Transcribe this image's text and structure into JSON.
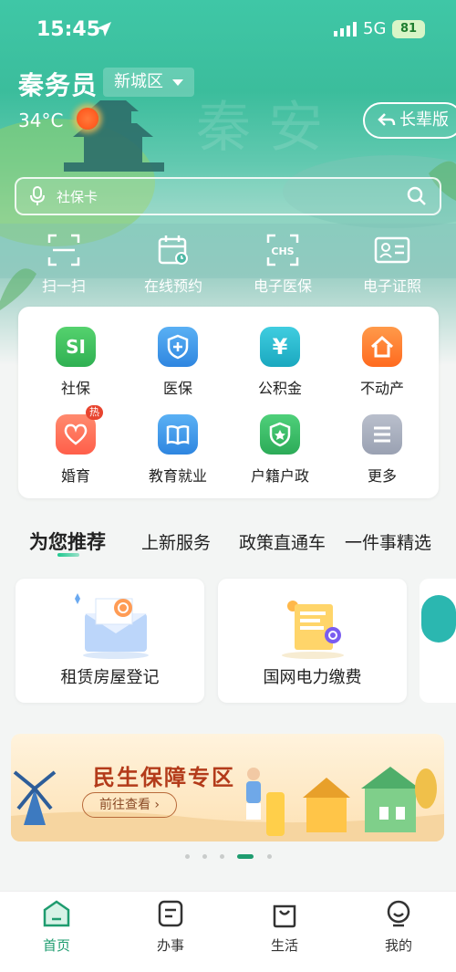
{
  "status_bar": {
    "time": "15:45",
    "network": "5G",
    "battery": "81"
  },
  "header": {
    "user_name": "秦务员",
    "district": "新城区",
    "temperature": "34°C",
    "elder_mode_label": "长辈版"
  },
  "search": {
    "placeholder": "社保卡"
  },
  "quick_actions": [
    {
      "label": "扫一扫",
      "icon": "scan-icon"
    },
    {
      "label": "在线预约",
      "icon": "calendar-icon"
    },
    {
      "label": "电子医保",
      "icon": "chs-icon"
    },
    {
      "label": "电子证照",
      "icon": "id-card-icon"
    }
  ],
  "services": [
    {
      "label": "社保",
      "icon": "si-icon",
      "color": "#3cc15a",
      "glyph": "SI"
    },
    {
      "label": "医保",
      "icon": "shield-plus-icon",
      "color": "#3a93e8",
      "glyph": "✚"
    },
    {
      "label": "公积金",
      "icon": "yen-icon",
      "color": "#23b6c9",
      "glyph": "¥"
    },
    {
      "label": "不动产",
      "icon": "house-icon",
      "color": "#ff7f2a",
      "glyph": "⌂"
    },
    {
      "label": "婚育",
      "icon": "heart-icon",
      "color": "#ff6f5c",
      "glyph": "♡",
      "badge": "热"
    },
    {
      "label": "教育就业",
      "icon": "book-icon",
      "color": "#3a93e8",
      "glyph": "▥"
    },
    {
      "label": "户籍户政",
      "icon": "badge-star-icon",
      "color": "#3cba6a",
      "glyph": "★"
    },
    {
      "label": "更多",
      "icon": "more-icon",
      "color": "#a8aebd",
      "glyph": "≡"
    }
  ],
  "recommend_tabs": [
    {
      "label": "为您推荐",
      "active": true
    },
    {
      "label": "上新服务",
      "active": false
    },
    {
      "label": "政策直通车",
      "active": false
    },
    {
      "label": "一件事精选",
      "active": false
    }
  ],
  "recommend_cards": [
    {
      "label": "租赁房屋登记",
      "icon": "envelope-search-icon"
    },
    {
      "label": "国网电力缴费",
      "icon": "bill-search-icon"
    }
  ],
  "banner": {
    "title": "民生保障专区",
    "button": "前往查看 ›"
  },
  "carousel": {
    "count": 5,
    "active_index": 3
  },
  "bottom_nav": [
    {
      "label": "首页",
      "icon": "home-icon",
      "active": true
    },
    {
      "label": "办事",
      "icon": "document-icon",
      "active": false
    },
    {
      "label": "生活",
      "icon": "bag-icon",
      "active": false
    },
    {
      "label": "我的",
      "icon": "smile-icon",
      "active": false
    }
  ],
  "colors": {
    "primary": "#1e9c6f",
    "hero_top": "#3fc7a6",
    "text": "#222222"
  }
}
